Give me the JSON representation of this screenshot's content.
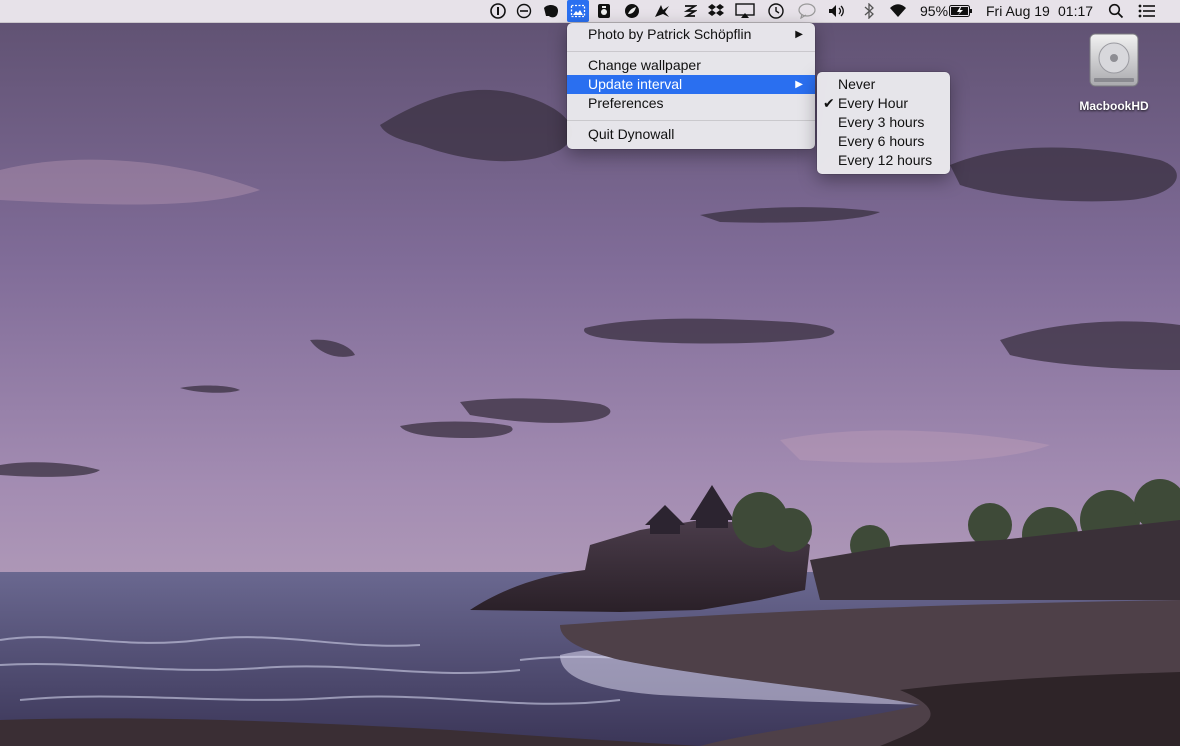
{
  "menubar": {
    "battery_percent": "95%",
    "date": "Fri Aug 19",
    "time": "01:17",
    "icons": [
      "onepassword-icon",
      "do-not-disturb-icon",
      "evernote-icon",
      "dynowall-icon",
      "app-icon",
      "app-icon",
      "paw-icon",
      "app-icon",
      "dropbox-icon",
      "airplay-icon",
      "time-machine-icon",
      "messages-icon",
      "volume-icon",
      "bluetooth-icon",
      "wifi-icon",
      "battery-icon",
      "spotlight-icon",
      "notification-center-icon"
    ]
  },
  "dynowall_menu": {
    "photo_credit": "Photo by Patrick Schöpflin",
    "change_wallpaper": "Change wallpaper",
    "update_interval": "Update interval",
    "preferences": "Preferences",
    "quit": "Quit Dynowall"
  },
  "interval_submenu": {
    "options": [
      "Never",
      "Every Hour",
      "Every 3 hours",
      "Every 6 hours",
      "Every 12 hours"
    ],
    "selected": "Every Hour"
  },
  "desktop": {
    "drive_label": "MacbookHD"
  },
  "colors": {
    "highlight": "#2a6ff0",
    "sky_top": "#6a5880",
    "sky_bottom": "#a28aae",
    "sea": "#4e4e7a"
  }
}
